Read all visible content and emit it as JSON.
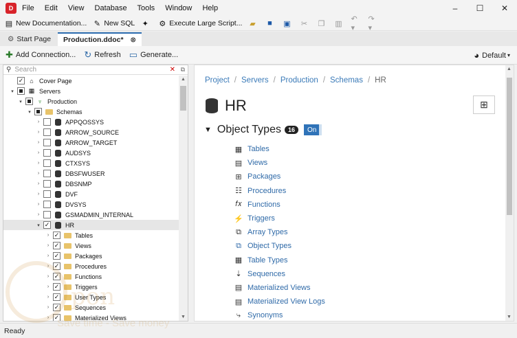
{
  "menu": [
    "File",
    "Edit",
    "View",
    "Database",
    "Tools",
    "Window",
    "Help"
  ],
  "toolbar": {
    "new_documentation": "New Documentation...",
    "new_sql": "New SQL",
    "execute_large_script": "Execute Large Script..."
  },
  "tabs": [
    {
      "label": "Start Page"
    },
    {
      "label": "Production.ddoc*"
    }
  ],
  "actions": {
    "add_connection": "Add Connection...",
    "refresh": "Refresh",
    "generate": "Generate...",
    "theme": "Default"
  },
  "search": {
    "placeholder": "Search"
  },
  "tree": [
    {
      "label": "Cover Page",
      "level": 0,
      "check": "checked",
      "icon": "house-icon",
      "exp": ""
    },
    {
      "label": "Servers",
      "level": 0,
      "check": "partial",
      "icon": "servers-icon",
      "exp": "▾"
    },
    {
      "label": "Production",
      "level": 1,
      "check": "partial",
      "icon": "server-icon",
      "exp": "▾"
    },
    {
      "label": "Schemas",
      "level": 2,
      "check": "partial",
      "icon": "folder-icon",
      "exp": "▾"
    },
    {
      "label": "APPQOSSYS",
      "level": 3,
      "check": "none",
      "icon": "schema-icon",
      "exp": "›"
    },
    {
      "label": "ARROW_SOURCE",
      "level": 3,
      "check": "none",
      "icon": "schema-icon",
      "exp": "›"
    },
    {
      "label": "ARROW_TARGET",
      "level": 3,
      "check": "none",
      "icon": "schema-icon",
      "exp": "›"
    },
    {
      "label": "AUDSYS",
      "level": 3,
      "check": "none",
      "icon": "schema-icon",
      "exp": "›"
    },
    {
      "label": "CTXSYS",
      "level": 3,
      "check": "none",
      "icon": "schema-icon",
      "exp": "›"
    },
    {
      "label": "DBSFWUSER",
      "level": 3,
      "check": "none",
      "icon": "schema-icon",
      "exp": "›"
    },
    {
      "label": "DBSNMP",
      "level": 3,
      "check": "none",
      "icon": "schema-icon",
      "exp": "›"
    },
    {
      "label": "DVF",
      "level": 3,
      "check": "none",
      "icon": "schema-icon",
      "exp": "›"
    },
    {
      "label": "DVSYS",
      "level": 3,
      "check": "none",
      "icon": "schema-icon",
      "exp": "›"
    },
    {
      "label": "GSMADMIN_INTERNAL",
      "level": 3,
      "check": "none",
      "icon": "schema-icon",
      "exp": "›"
    },
    {
      "label": "HR",
      "level": 3,
      "check": "checked",
      "icon": "schema-icon",
      "exp": "▾",
      "selected": true
    },
    {
      "label": "Tables",
      "level": 4,
      "check": "checked",
      "icon": "folder-icon",
      "exp": "›"
    },
    {
      "label": "Views",
      "level": 4,
      "check": "checked",
      "icon": "folder-icon",
      "exp": "›"
    },
    {
      "label": "Packages",
      "level": 4,
      "check": "checked",
      "icon": "folder-icon",
      "exp": "›"
    },
    {
      "label": "Procedures",
      "level": 4,
      "check": "checked",
      "icon": "folder-icon",
      "exp": "›"
    },
    {
      "label": "Functions",
      "level": 4,
      "check": "checked",
      "icon": "folder-icon",
      "exp": "›"
    },
    {
      "label": "Triggers",
      "level": 4,
      "check": "checked",
      "icon": "folder-icon",
      "exp": "›"
    },
    {
      "label": "User Types",
      "level": 4,
      "check": "checked",
      "icon": "folder-icon",
      "exp": "›"
    },
    {
      "label": "Sequences",
      "level": 4,
      "check": "checked",
      "icon": "folder-icon",
      "exp": "›"
    },
    {
      "label": "Materialized Views",
      "level": 4,
      "check": "checked",
      "icon": "folder-icon",
      "exp": "›"
    }
  ],
  "breadcrumb": [
    "Project",
    "Servers",
    "Production",
    "Schemas",
    "HR"
  ],
  "page_title": "HR",
  "section": {
    "title": "Object Types",
    "count": "16",
    "toggle": "On"
  },
  "object_types": [
    {
      "label": "Tables",
      "icon": "table-icon"
    },
    {
      "label": "Views",
      "icon": "view-icon"
    },
    {
      "label": "Packages",
      "icon": "package-icon"
    },
    {
      "label": "Procedures",
      "icon": "procedure-icon"
    },
    {
      "label": "Functions",
      "icon": "function-icon"
    },
    {
      "label": "Triggers",
      "icon": "trigger-icon"
    },
    {
      "label": "Array Types",
      "icon": "array-type-icon"
    },
    {
      "label": "Object Types",
      "icon": "object-type-icon"
    },
    {
      "label": "Table Types",
      "icon": "table-type-icon"
    },
    {
      "label": "Sequences",
      "icon": "sequence-icon"
    },
    {
      "label": "Materialized Views",
      "icon": "materialized-view-icon"
    },
    {
      "label": "Materialized View Logs",
      "icon": "materialized-view-log-icon"
    },
    {
      "label": "Synonyms",
      "icon": "synonym-icon"
    }
  ],
  "status": "Ready",
  "watermark": {
    "text": "pon",
    "sub": "Save time - Save money"
  }
}
